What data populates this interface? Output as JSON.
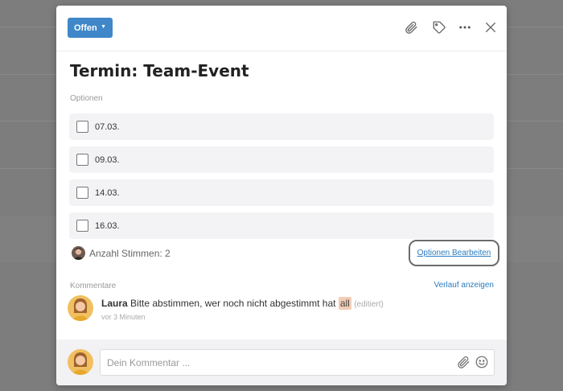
{
  "header": {
    "status_label": "Offen",
    "icons": [
      "paperclip-icon",
      "tag-icon",
      "more-icon",
      "close-icon"
    ]
  },
  "title": "Termin: Team-Event",
  "options_section": {
    "label": "Optionen",
    "items": [
      {
        "label": "07.03.",
        "checked": false
      },
      {
        "label": "09.03.",
        "checked": false
      },
      {
        "label": "14.03.",
        "checked": false
      },
      {
        "label": "16.03.",
        "checked": false
      }
    ]
  },
  "votes_text": "Anzahl Stimmen: 2",
  "edit_options_label": "Optionen Bearbeiten",
  "comments_section": {
    "label": "Kommentare",
    "history_link": "Verlauf anzeigen",
    "comments": [
      {
        "author": "Laura",
        "text": "Bitte abstimmen, wer noch nicht abgestimmt hat",
        "mention": "all",
        "edited": "(editiert)",
        "time": "vor 3 Minuten"
      }
    ]
  },
  "comment_input": {
    "placeholder": "Dein Kommentar ...",
    "value": ""
  },
  "colors": {
    "accent": "#3f87c9",
    "link": "#2b7cc0",
    "mention_bg": "#f2cdb4"
  }
}
